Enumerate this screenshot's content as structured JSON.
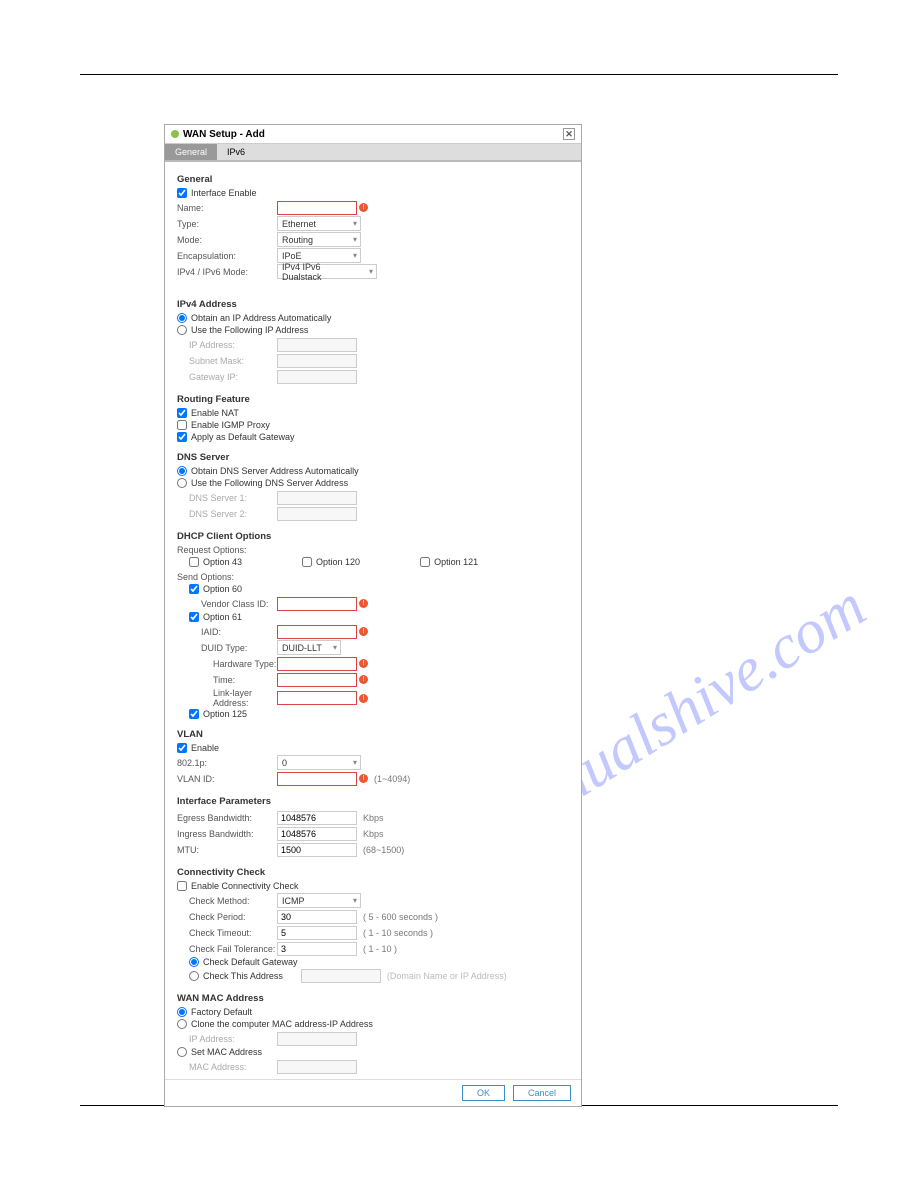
{
  "dialog": {
    "title": "WAN Setup - Add"
  },
  "tabs": {
    "general": "General",
    "ipv6": "IPv6"
  },
  "general": {
    "title": "General",
    "interface_enable": "Interface Enable",
    "name_lbl": "Name:",
    "type_lbl": "Type:",
    "type_val": "Ethernet",
    "mode_lbl": "Mode:",
    "mode_val": "Routing",
    "encap_lbl": "Encapsulation:",
    "encap_val": "IPoE",
    "ipmode_lbl": "IPv4 / IPv6 Mode:",
    "ipmode_val": "IPv4 IPv6 Dualstack"
  },
  "ipv4": {
    "title": "IPv4 Address",
    "auto": "Obtain an IP Address Automatically",
    "manual": "Use the Following IP Address",
    "ip_lbl": "IP Address:",
    "subnet_lbl": "Subnet Mask:",
    "gw_lbl": "Gateway IP:"
  },
  "routing": {
    "title": "Routing Feature",
    "nat": "Enable NAT",
    "igmp": "Enable IGMP Proxy",
    "defgw": "Apply as Default Gateway"
  },
  "dns": {
    "title": "DNS Server",
    "auto": "Obtain DNS Server Address Automatically",
    "manual": "Use the Following DNS Server Address",
    "dns1": "DNS Server 1:",
    "dns2": "DNS Server 2:"
  },
  "dhcp": {
    "title": "DHCP Client Options",
    "req": "Request Options:",
    "opt43": "Option 43",
    "opt120": "Option 120",
    "opt121": "Option 121",
    "send": "Send Options:",
    "opt60": "Option 60",
    "vendor_lbl": "Vendor Class ID:",
    "opt61": "Option 61",
    "iaid_lbl": "IAID:",
    "duid_lbl": "DUID Type:",
    "duid_val": "DUID-LLT",
    "hw_lbl": "Hardware Type:",
    "time_lbl": "Time:",
    "ll_lbl": "Link-layer Address:",
    "opt125": "Option 125"
  },
  "vlan": {
    "title": "VLAN",
    "enable": "Enable",
    "p_lbl": "802.1p:",
    "p_val": "0",
    "id_lbl": "VLAN ID:",
    "range": "(1~4094)"
  },
  "ifparams": {
    "title": "Interface Parameters",
    "eg_lbl": "Egress Bandwidth:",
    "eg_val": "1048576",
    "kbps": "Kbps",
    "in_lbl": "Ingress Bandwidth:",
    "in_val": "1048576",
    "mtu_lbl": "MTU:",
    "mtu_val": "1500",
    "mtu_range": "(68~1500)"
  },
  "conn": {
    "title": "Connectivity Check",
    "enable": "Enable Connectivity Check",
    "method_lbl": "Check Method:",
    "method_val": "ICMP",
    "period_lbl": "Check Period:",
    "period_val": "30",
    "period_range": "( 5 - 600 seconds )",
    "timeout_lbl": "Check Timeout:",
    "timeout_val": "5",
    "timeout_range": "( 1 - 10 seconds )",
    "fail_lbl": "Check Fail Tolerance:",
    "fail_val": "3",
    "fail_range": "( 1 - 10 )",
    "defgw": "Check Default Gateway",
    "thisaddr": "Check This Address",
    "placeholder": "(Domain Name or IP Address)"
  },
  "mac": {
    "title": "WAN MAC Address",
    "factory": "Factory Default",
    "clone": "Clone the computer MAC address-IP Address",
    "ip_lbl": "IP Address:",
    "set": "Set MAC Address",
    "mac_lbl": "MAC Address:"
  },
  "footer": {
    "ok": "OK",
    "cancel": "Cancel"
  },
  "watermark": "manualshive.com",
  "err": "!"
}
